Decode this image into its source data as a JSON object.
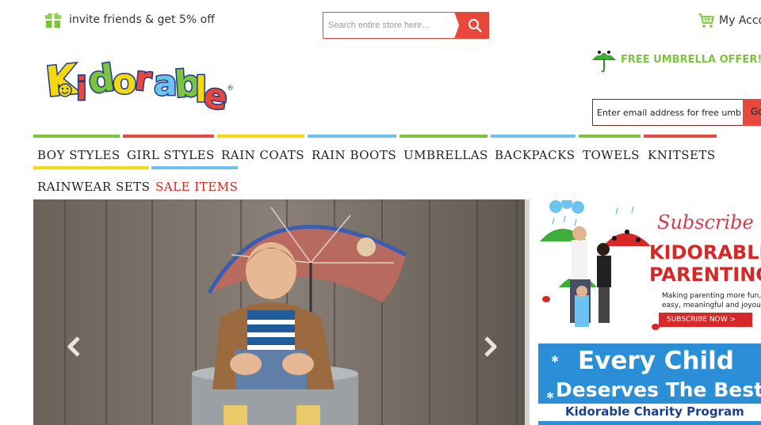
{
  "top_bar": {
    "invite_text": "invite friends & get 5% off",
    "search_placeholder": "Search entire store here...",
    "account_label": "My Acco"
  },
  "logo": {
    "text": "Kidorable",
    "registered": "®"
  },
  "promo": {
    "text": "FREE UMBRELLA OFFER!"
  },
  "newsletter": {
    "placeholder": "Enter email address for free umbrella",
    "button_label": "Go"
  },
  "nav": {
    "items": [
      {
        "label": "BOY STYLES",
        "color": "#7cc43e"
      },
      {
        "label": "GIRL STYLES",
        "color": "#e8473c"
      },
      {
        "label": "RAIN COATS",
        "color": "#f5d90b"
      },
      {
        "label": "RAIN BOOTS",
        "color": "#6cc3ef"
      },
      {
        "label": "UMBRELLAS",
        "color": "#7cc43e"
      },
      {
        "label": "BACKPACKS",
        "color": "#6cc3ef"
      },
      {
        "label": "TOWELS",
        "color": "#7cc43e"
      },
      {
        "label": "KNITSETS",
        "color": "#e8473c"
      },
      {
        "label": "RAINWEAR SETS",
        "color": "#f5d90b"
      },
      {
        "label": "SALE ITEMS",
        "color": "#6cc3ef"
      }
    ]
  },
  "carousel": {
    "prev_icon": "chevron-left-icon",
    "next_icon": "chevron-right-icon"
  },
  "banners": {
    "subscribe": {
      "script_title": "Subscribe",
      "title_line1": "KIDORABLE",
      "title_line2": "PARENTING",
      "tagline_line1": "Making parenting more fun,",
      "tagline_line2": "easy, meaningful and joyous",
      "cta": "SUBSCRIBE NOW >"
    },
    "charity": {
      "line1": "Every Child",
      "line2": "Deserves The Best",
      "line3": "Kidorable Charity Program"
    }
  },
  "colors": {
    "accent_red": "#e8473c",
    "brand_green": "#7cc43e",
    "brand_yellow": "#f5d90b",
    "brand_blue": "#6cc3ef",
    "sale_red": "#d9261c"
  }
}
